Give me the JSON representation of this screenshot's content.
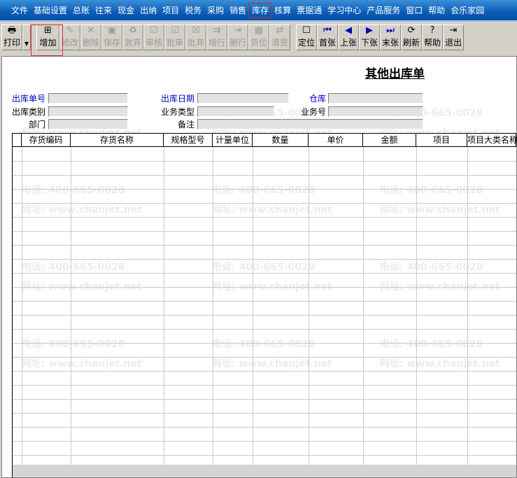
{
  "menu": [
    "文件",
    "基础设置",
    "总账",
    "往来",
    "现金",
    "出纳",
    "项目",
    "税务",
    "采购",
    "销售",
    "库存",
    "核算",
    "票据通",
    "学习中心",
    "产品服务",
    "窗口",
    "帮助",
    "会乐家园"
  ],
  "menu_selected": "库存",
  "toolbar": [
    {
      "label": "打印",
      "icon": "printer-icon",
      "glyph": "🖶",
      "enabled": true
    },
    {
      "label": "增加",
      "icon": "add-icon",
      "glyph": "⊞",
      "enabled": true
    },
    {
      "label": "修改",
      "icon": "edit-icon",
      "glyph": "✎",
      "enabled": false
    },
    {
      "label": "删除",
      "icon": "delete-icon",
      "glyph": "✕",
      "enabled": false
    },
    {
      "label": "保存",
      "icon": "save-icon",
      "glyph": "▣",
      "enabled": false
    },
    {
      "label": "放弃",
      "icon": "discard-icon",
      "glyph": "♻",
      "enabled": false
    },
    {
      "label": "审核",
      "icon": "audit-icon",
      "glyph": "☑",
      "enabled": false
    },
    {
      "label": "批审",
      "icon": "batch-audit-icon",
      "glyph": "☑",
      "enabled": false
    },
    {
      "label": "批弃",
      "icon": "batch-discard-icon",
      "glyph": "☒",
      "enabled": false
    },
    {
      "label": "增行",
      "icon": "add-row-icon",
      "glyph": "⇉",
      "enabled": false
    },
    {
      "label": "删行",
      "icon": "delete-row-icon",
      "glyph": "⇥",
      "enabled": false
    },
    {
      "label": "货位",
      "icon": "location-icon",
      "glyph": "▦",
      "enabled": false
    },
    {
      "label": "清货",
      "icon": "clear-icon",
      "glyph": "⇄",
      "enabled": false
    },
    {
      "label": "定位",
      "icon": "locate-icon",
      "glyph": "☐",
      "enabled": true
    },
    {
      "label": "首张",
      "icon": "first-icon",
      "glyph": "⏮",
      "enabled": true
    },
    {
      "label": "上张",
      "icon": "prev-icon",
      "glyph": "◀",
      "enabled": true
    },
    {
      "label": "下张",
      "icon": "next-icon",
      "glyph": "▶",
      "enabled": true
    },
    {
      "label": "末张",
      "icon": "last-icon",
      "glyph": "⏭",
      "enabled": true
    },
    {
      "label": "刷新",
      "icon": "refresh-icon",
      "glyph": "⟳",
      "enabled": true
    },
    {
      "label": "帮助",
      "icon": "help-icon",
      "glyph": "?",
      "enabled": true
    },
    {
      "label": "退出",
      "icon": "exit-icon",
      "glyph": "⇥",
      "enabled": true
    }
  ],
  "form": {
    "title": "其他出库单",
    "fields": {
      "out_no": "出库单号",
      "out_date": "出库日期",
      "warehouse": "仓库",
      "out_type": "出库类别",
      "biz_type": "业务类型",
      "biz_no": "业务号",
      "dept": "部门",
      "remark": "备注"
    },
    "values": {
      "out_no": "",
      "out_date": "",
      "warehouse": "",
      "out_type": "",
      "biz_type": "",
      "biz_no": "",
      "dept": "",
      "remark": ""
    }
  },
  "grid": {
    "columns": [
      "存货编码",
      "存货名称",
      "规格型号",
      "计量单位",
      "数量",
      "单价",
      "金额",
      "项目",
      "项目大类名称"
    ],
    "rows": []
  },
  "watermark": {
    "phone": "电话: 400-665-0028",
    "site": "网址: www.chanjet.net"
  }
}
